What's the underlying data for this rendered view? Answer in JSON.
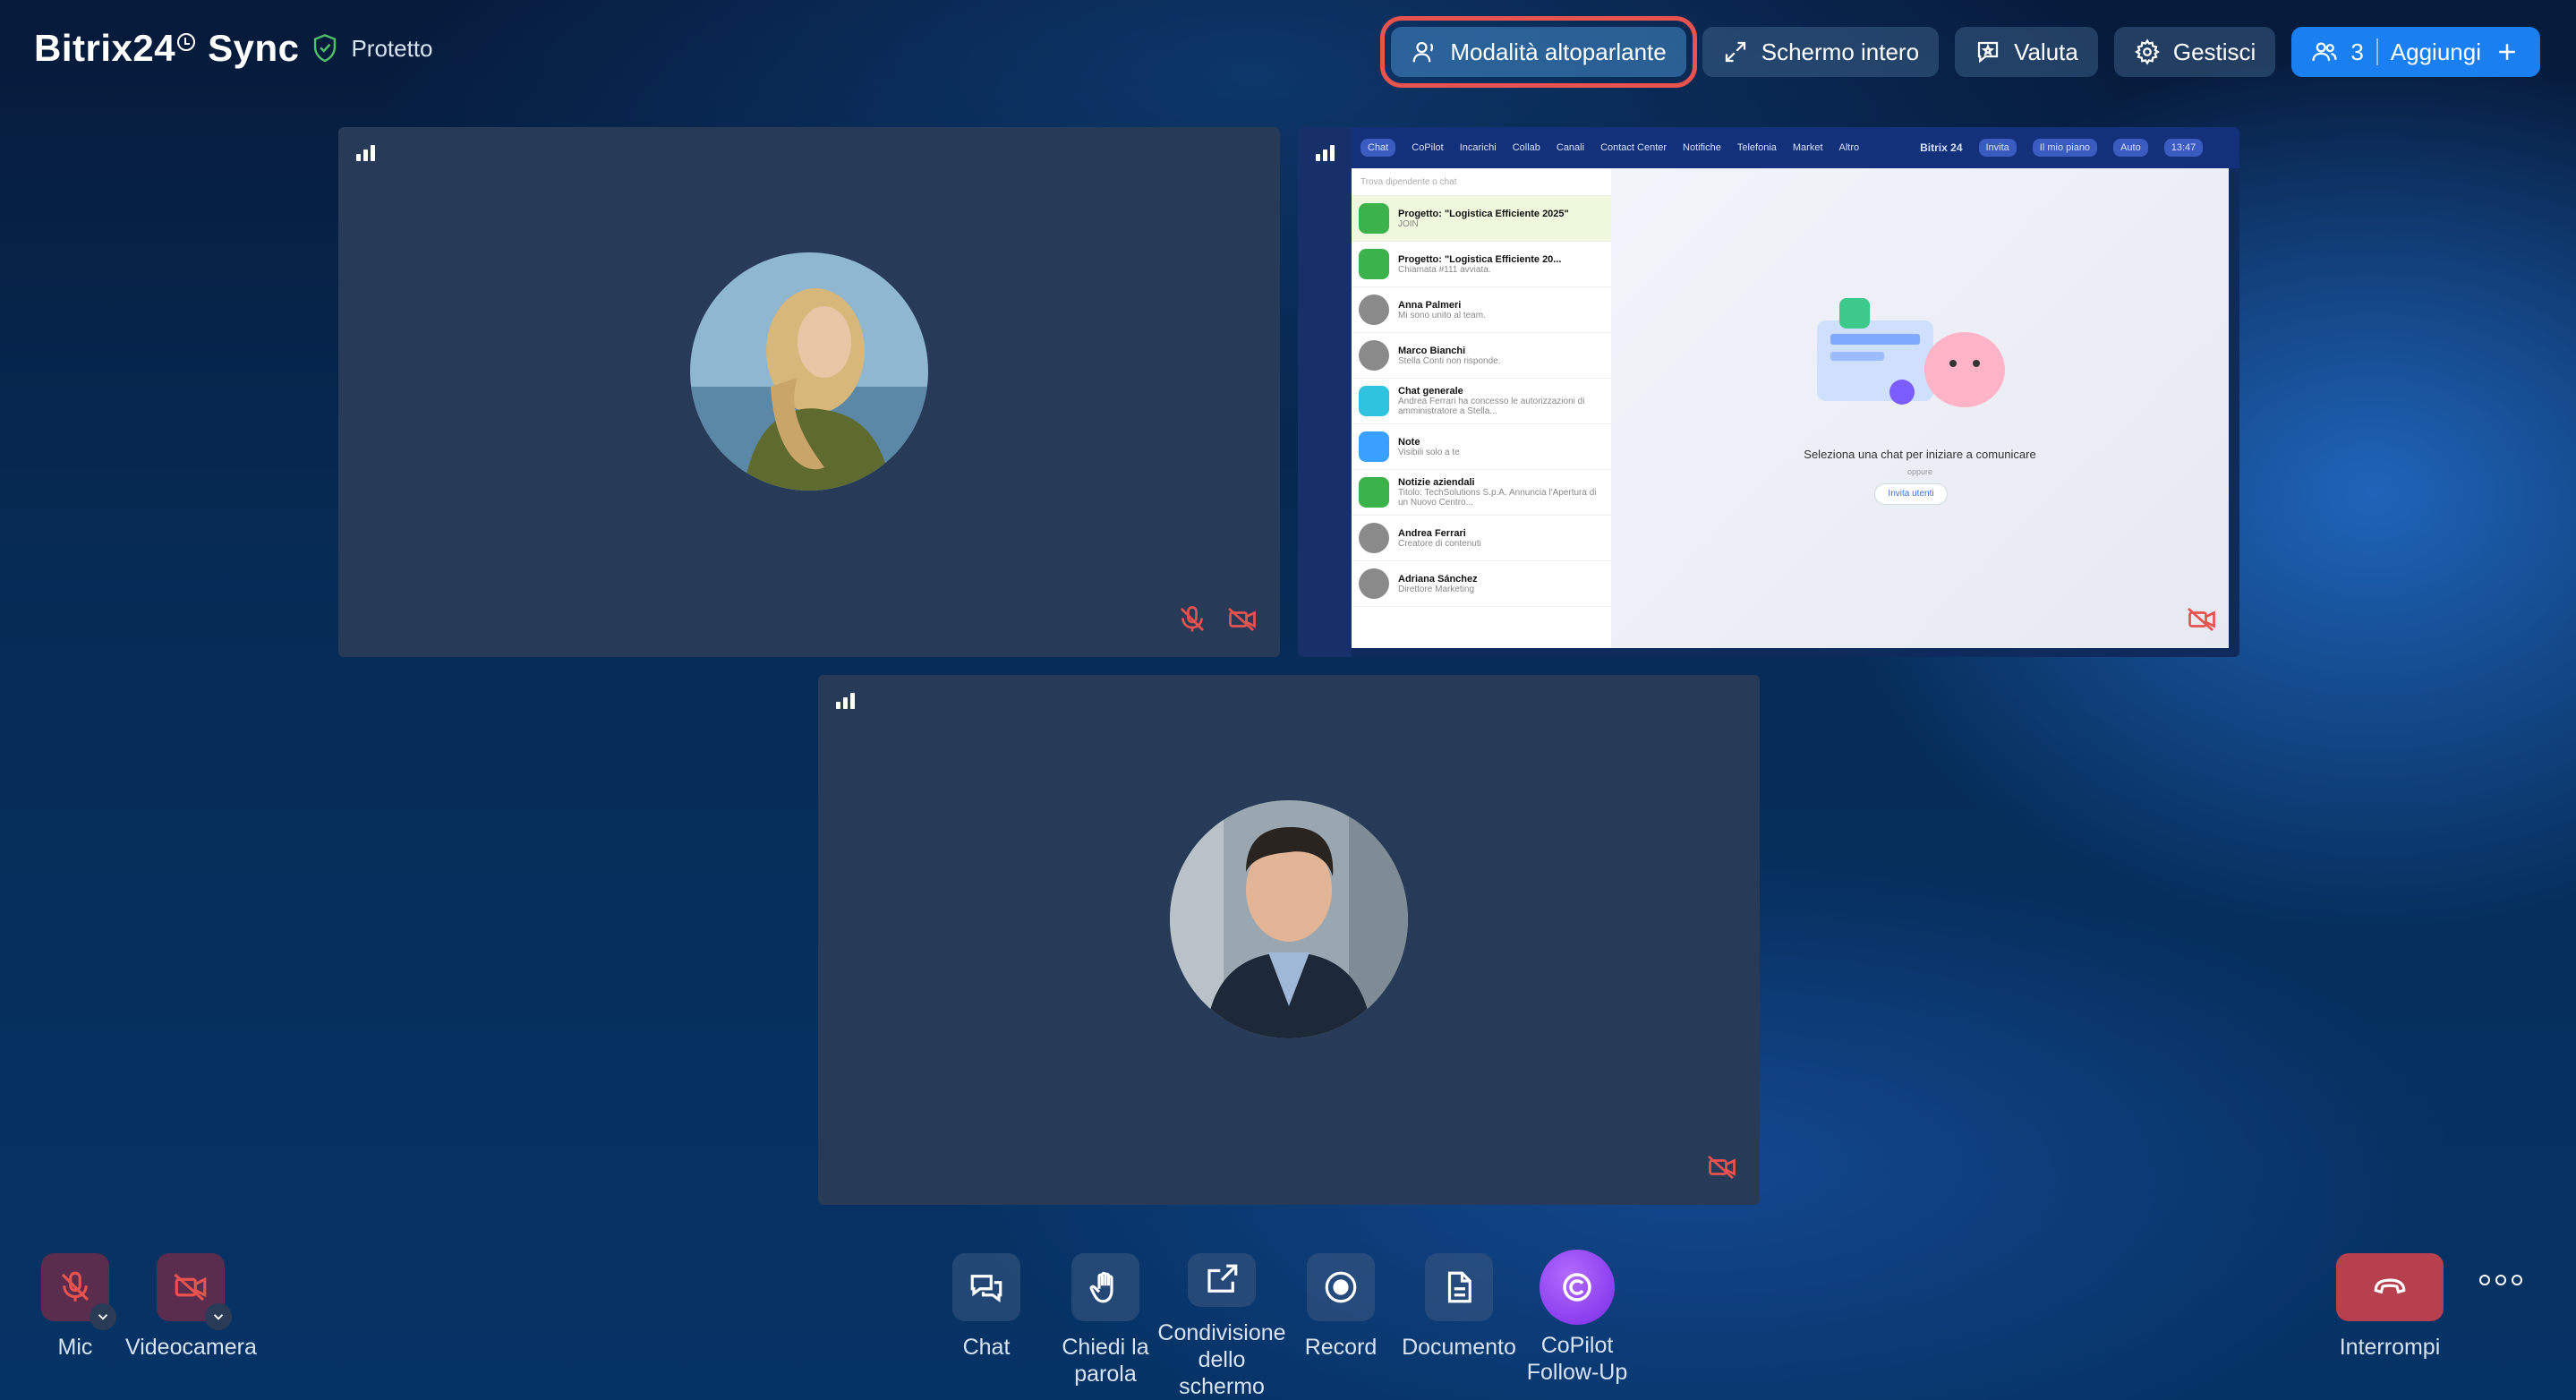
{
  "header": {
    "brand": "Bitrix24",
    "brand_suffix": "Sync",
    "security_label": "Protetto"
  },
  "top_actions": {
    "speaker_mode": "Modalità altoparlante",
    "fullscreen": "Schermo intero",
    "rate": "Valuta",
    "manage": "Gestisci",
    "participants_count": "3",
    "add": "Aggiungi"
  },
  "screen_share": {
    "nav": [
      "Chat",
      "CoPilot",
      "Incarichi",
      "Collab",
      "Canali",
      "Contact Center",
      "Notifiche",
      "Telefonia",
      "Market",
      "Altro"
    ],
    "brand": "Bitrix 24",
    "actions": [
      "Invita",
      "Il mio piano",
      "Auto"
    ],
    "time": "13:47",
    "search_placeholder": "Trova dipendente o chat",
    "chats": [
      {
        "title": "Progetto: \"Logistica Efficiente 2025\"",
        "sub": "JOIN"
      },
      {
        "title": "Progetto: \"Logistica Efficiente 20...",
        "sub": "Chiamata #111 avviata."
      },
      {
        "title": "Anna Palmeri",
        "sub": "Mi sono unito al team."
      },
      {
        "title": "Marco Bianchi",
        "sub": "Stella Conti non risponde."
      },
      {
        "title": "Chat generale",
        "sub": "Andrea Ferrari ha concesso le autorizzazioni di amministratore a Stella..."
      },
      {
        "title": "Note",
        "sub": "Visibili solo a te"
      },
      {
        "title": "Notizie aziendali",
        "sub": "Titolo: TechSolutions S.p.A. Annuncia l'Apertura di un Nuovo Centro..."
      },
      {
        "title": "Andrea Ferrari",
        "sub": "Creatore di contenuti"
      },
      {
        "title": "Adriana Sánchez",
        "sub": "Direttore Marketing"
      }
    ],
    "empty_title": "Seleziona una chat per iniziare a comunicare",
    "empty_or": "oppure",
    "invite": "Invita utenti"
  },
  "controls": {
    "mic": "Mic",
    "camera": "Videocamera",
    "chat": "Chat",
    "raise_hand": "Chiedi la parola",
    "screen_share": "Condivisione dello schermo",
    "record": "Record",
    "document": "Documento",
    "copilot": "CoPilot Follow-Up",
    "hangup": "Interrompi"
  },
  "colors": {
    "accent": "#1a7ff0",
    "highlight": "#e8524f",
    "muted_red": "#e8524f",
    "copilot": "#8a3cf0"
  }
}
